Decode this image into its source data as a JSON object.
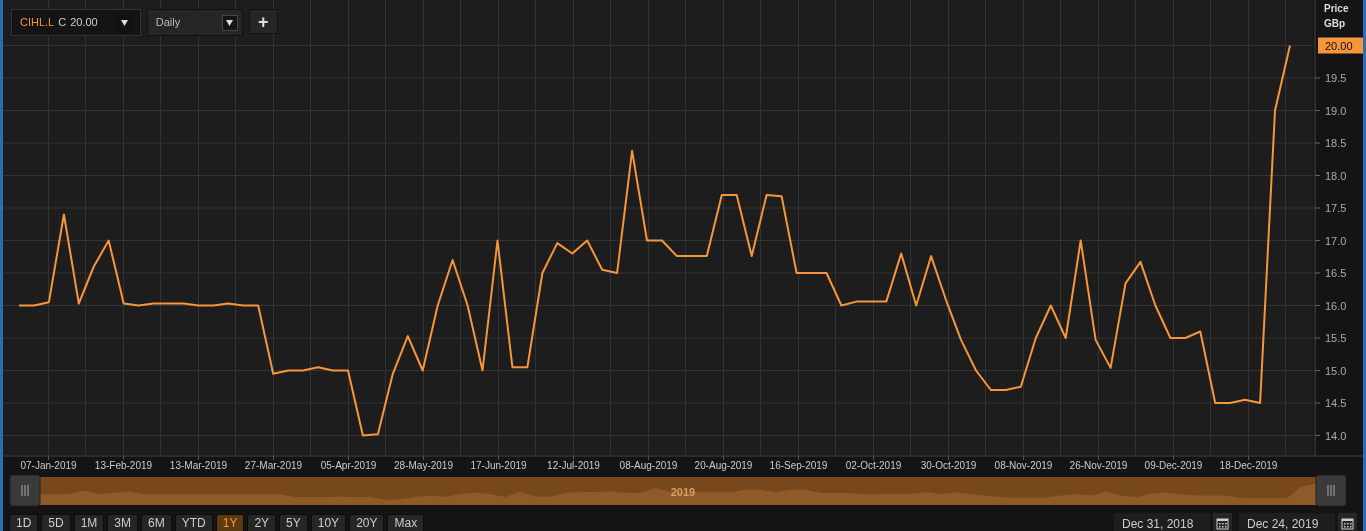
{
  "toolbar": {
    "symbol": "CIHL.L",
    "quote_label": "C",
    "quote_value": "20.00",
    "interval": "Daily",
    "add_button": "+"
  },
  "chart": {
    "axis_title": "Price",
    "axis_unit": "GBp",
    "last_price": "20.00",
    "x_axis_labels": [
      "07-Jan-2019",
      "13-Feb-2019",
      "13-Mar-2019",
      "27-Mar-2019",
      "05-Apr-2019",
      "28-May-2019",
      "17-Jun-2019",
      "12-Jul-2019",
      "08-Aug-2019",
      "20-Aug-2019",
      "16-Sep-2019",
      "02-Oct-2019",
      "30-Oct-2019",
      "08-Nov-2019",
      "26-Nov-2019",
      "09-Dec-2019",
      "18-Dec-2019"
    ],
    "chart_data": {
      "type": "line",
      "grid": true,
      "ylim": [
        13.7,
        20.7
      ],
      "series": [
        {
          "color": "#f7953a",
          "values": [
            16.0,
            16.0,
            16.05,
            17.4,
            16.03,
            16.6,
            17.0,
            16.03,
            16.0,
            16.03,
            16.03,
            16.03,
            16.0,
            16.0,
            16.03,
            16.0,
            16.0,
            14.95,
            15.0,
            15.0,
            15.05,
            15.0,
            15.0,
            14.0,
            14.02,
            14.95,
            15.53,
            15.0,
            16.0,
            16.7,
            16.0,
            15.0,
            17.0,
            15.05,
            15.05,
            16.5,
            16.96,
            16.8,
            17.0,
            16.55,
            16.5,
            18.38,
            17.0,
            17.0,
            16.76,
            16.76,
            16.76,
            17.7,
            17.7,
            16.76,
            17.7,
            17.68,
            16.5,
            16.5,
            16.5,
            16.0,
            16.06,
            16.06,
            16.06,
            16.8,
            16.0,
            16.76,
            16.08,
            15.47,
            15.0,
            14.7,
            14.7,
            14.75,
            15.5,
            16.0,
            15.5,
            17.0,
            15.47,
            15.04,
            16.34,
            16.67,
            16.0,
            15.5,
            15.5,
            15.6,
            14.5,
            14.5,
            14.55,
            14.5,
            19.0,
            20.0
          ]
        }
      ],
      "yticks": [
        {
          "value": 14,
          "label": "14.0"
        },
        {
          "value": 14.5,
          "label": "14.5"
        },
        {
          "value": 15,
          "label": "15.0"
        },
        {
          "value": 15.5,
          "label": "15.5"
        },
        {
          "value": 16,
          "label": "16.0"
        },
        {
          "value": 16.5,
          "label": "16.5"
        },
        {
          "value": 17,
          "label": "17.0"
        },
        {
          "value": 17.5,
          "label": "17.5"
        },
        {
          "value": 18,
          "label": "18.0"
        },
        {
          "value": 18.5,
          "label": "18.5"
        },
        {
          "value": 19,
          "label": "19.0"
        },
        {
          "value": 19.5,
          "label": "19.5"
        }
      ]
    }
  },
  "navigator": {
    "label": "2019"
  },
  "ranges": [
    {
      "label": "1D",
      "selected": false
    },
    {
      "label": "5D",
      "selected": false
    },
    {
      "label": "1M",
      "selected": false
    },
    {
      "label": "3M",
      "selected": false
    },
    {
      "label": "6M",
      "selected": false
    },
    {
      "label": "YTD",
      "selected": false
    },
    {
      "label": "1Y",
      "selected": true
    },
    {
      "label": "2Y",
      "selected": false
    },
    {
      "label": "5Y",
      "selected": false
    },
    {
      "label": "10Y",
      "selected": false
    },
    {
      "label": "20Y",
      "selected": false
    },
    {
      "label": "Max",
      "selected": false
    }
  ],
  "date_range": {
    "from": "Dec 31, 2018",
    "to": "Dec 24, 2019"
  }
}
